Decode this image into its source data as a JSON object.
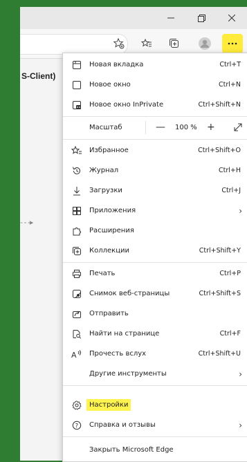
{
  "page": {
    "heading_fragment": "S-Client)"
  },
  "menu": {
    "items": [
      {
        "label": "Новая вкладка",
        "shortcut": "Ctrl+T"
      },
      {
        "label": "Новое окно",
        "shortcut": "Ctrl+N"
      },
      {
        "label": "Новое окно InPrivate",
        "shortcut": "Ctrl+Shift+N"
      }
    ],
    "zoom": {
      "label": "Масштаб",
      "minus": "—",
      "value": "100 %",
      "plus": "+"
    },
    "group2": [
      {
        "label": "Избранное",
        "shortcut": "Ctrl+Shift+O"
      },
      {
        "label": "Журнал",
        "shortcut": "Ctrl+H"
      },
      {
        "label": "Загрузки",
        "shortcut": "Ctrl+J"
      },
      {
        "label": "Приложения",
        "shortcut": ""
      },
      {
        "label": "Расширения",
        "shortcut": ""
      },
      {
        "label": "Коллекции",
        "shortcut": "Ctrl+Shift+Y"
      }
    ],
    "group3": [
      {
        "label": "Печать",
        "shortcut": "Ctrl+P"
      },
      {
        "label": "Снимок веб-страницы",
        "shortcut": "Ctrl+Shift+S"
      },
      {
        "label": "Отправить",
        "shortcut": ""
      },
      {
        "label": "Найти на странице",
        "shortcut": "Ctrl+F"
      },
      {
        "label": "Прочесть вслух",
        "shortcut": "Ctrl+Shift+U"
      },
      {
        "label": "Другие инструменты",
        "shortcut": ""
      }
    ],
    "group4": [
      {
        "label": "Настройки",
        "shortcut": ""
      },
      {
        "label": "Справка и отзывы",
        "shortcut": ""
      }
    ],
    "close": {
      "label": "Закрыть Microsoft Edge"
    }
  },
  "colors": {
    "highlight": "#ffeb3b",
    "desktop": "#2e7d32"
  },
  "icons": {
    "new_tab": "new-tab-icon",
    "new_window": "new-window-icon",
    "inprivate": "inprivate-icon",
    "favorites": "favorites-icon",
    "history": "history-icon",
    "downloads": "download-icon",
    "apps": "apps-icon",
    "extensions": "puzzle-icon",
    "collections": "collections-icon",
    "print": "printer-icon",
    "screenshot": "screenshot-icon",
    "share": "share-icon",
    "find": "find-icon",
    "read_aloud": "read-aloud-icon",
    "settings": "gear-icon",
    "help": "help-icon"
  }
}
